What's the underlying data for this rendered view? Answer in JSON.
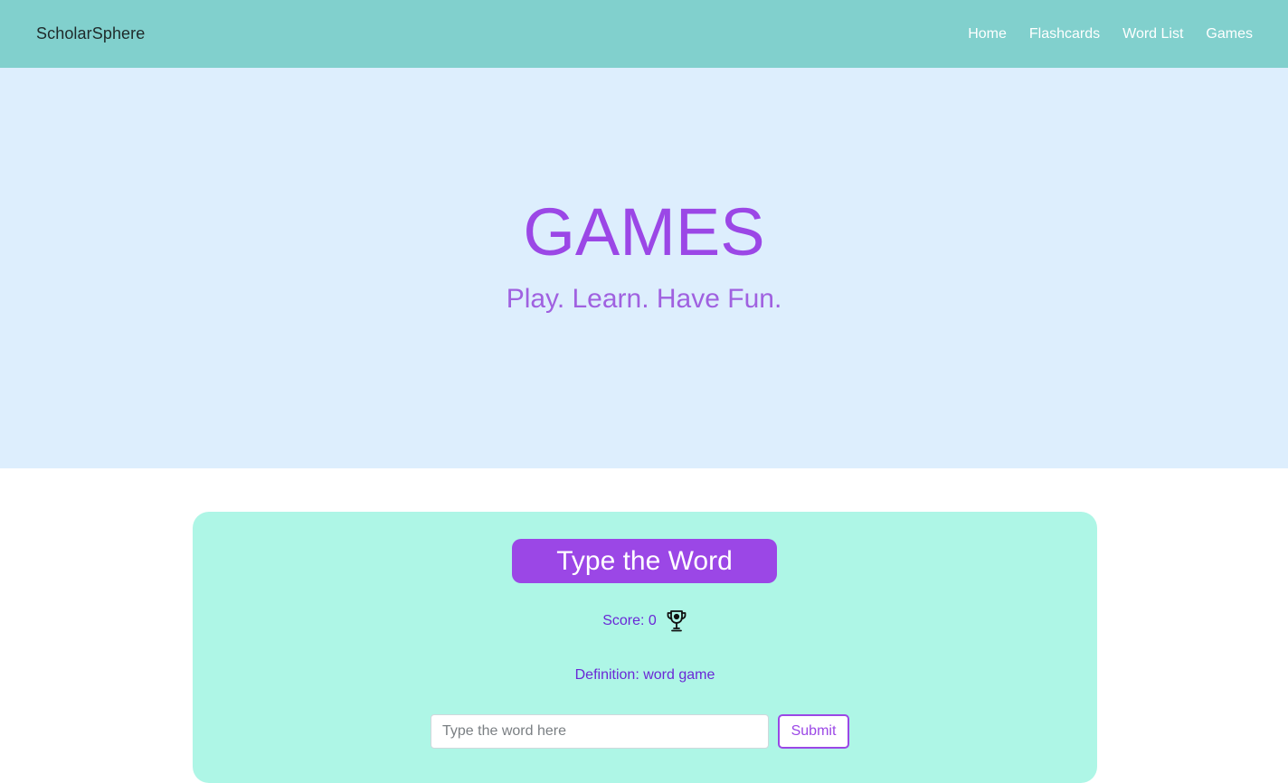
{
  "navbar": {
    "brand": "ScholarSphere",
    "links": [
      "Home",
      "Flashcards",
      "Word List",
      "Games"
    ]
  },
  "hero": {
    "title": "GAMES",
    "subtitle": "Play. Learn. Have Fun."
  },
  "game": {
    "title": "Type the Word",
    "score_label": "Score: 0",
    "score_icon": "trophy-icon",
    "definition": "Definition: word game",
    "input_placeholder": "Type the word here",
    "submit_label": "Submit"
  },
  "colors": {
    "navbar_bg": "#81d0cd",
    "hero_bg": "#ddeefd",
    "accent_purple": "#9b47e6",
    "card_bg": "#aef6e6"
  }
}
